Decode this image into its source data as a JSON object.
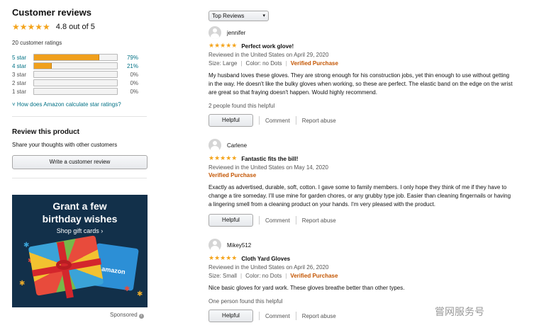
{
  "summary": {
    "title": "Customer reviews",
    "stars": "★★★★★",
    "rating_text": "4.8 out of 5",
    "ratings_count": "20 customer ratings",
    "histogram": [
      {
        "label": "5 star",
        "percent": "79%",
        "fraction": 0.79
      },
      {
        "label": "4 star",
        "percent": "21%",
        "fraction": 0.21
      },
      {
        "label": "3 star",
        "percent": "0%",
        "fraction": 0
      },
      {
        "label": "2 star",
        "percent": "0%",
        "fraction": 0
      },
      {
        "label": "1 star",
        "percent": "0%",
        "fraction": 0
      }
    ],
    "how_calculated": "How does Amazon calculate star ratings?"
  },
  "review_product": {
    "title": "Review this product",
    "subtitle": "Share your thoughts with other customers",
    "button": "Write a customer review"
  },
  "ad": {
    "headline_1": "Grant a few",
    "headline_2": "birthday wishes",
    "cta": "Shop gift cards ›",
    "card_text": "amazon",
    "sponsored": "Sponsored",
    "info_icon": "i"
  },
  "sort": {
    "selected": "Top Reviews",
    "caret": "▾"
  },
  "reviews": [
    {
      "author": "jennifer",
      "stars": "★★★★★",
      "headline": "Perfect work glove!",
      "date": "Reviewed in the United States on April 29, 2020",
      "size": "Size: Large",
      "color": "Color: no Dots",
      "verified": "Verified Purchase",
      "body": "My husband loves these gloves. They are strong enough for his construction jobs, yet thin enough to use without getting in the way. He doesn't like the bulky gloves when working, so these are perfect. The elastic band on the edge on the wrist are great so that fraying doesn't happen. Would highly recommend.",
      "helpful_count": "2 people found this helpful",
      "helpful_btn": "Helpful",
      "comment": "Comment",
      "report": "Report abuse"
    },
    {
      "author": "Carlene",
      "stars": "★★★★★",
      "headline": "Fantastic fits the bill!",
      "date": "Reviewed in the United States on May 14, 2020",
      "verified": "Verified Purchase",
      "body": "Exactly as advertised, durable, soft, cotton. I gave some to family members. I only hope they think of me if they have to change a tire someday. I'll use mine for garden chores, or any grubby type job. Easier than cleaning fingernails or having a lingering smell from a cleaning product on your hands. I'm very pleased with the product.",
      "helpful_btn": "Helpful",
      "comment": "Comment",
      "report": "Report abuse"
    },
    {
      "author": "Mikey512",
      "stars": "★★★★★",
      "headline": "Cloth Yard Gloves",
      "date": "Reviewed in the United States on April 26, 2020",
      "size": "Size: Small",
      "color": "Color: no Dots",
      "verified": "Verified Purchase",
      "body": "Nice basic gloves for yard work. These gloves breathe better than other types.",
      "helpful_count": "One person found this helpful",
      "helpful_btn": "Helpful",
      "comment": "Comment",
      "report": "Report abuse"
    }
  ],
  "watermark": "嘗网服务号",
  "colors": {
    "star": "#f4a41c",
    "link": "#007185",
    "verified": "#c45500"
  }
}
